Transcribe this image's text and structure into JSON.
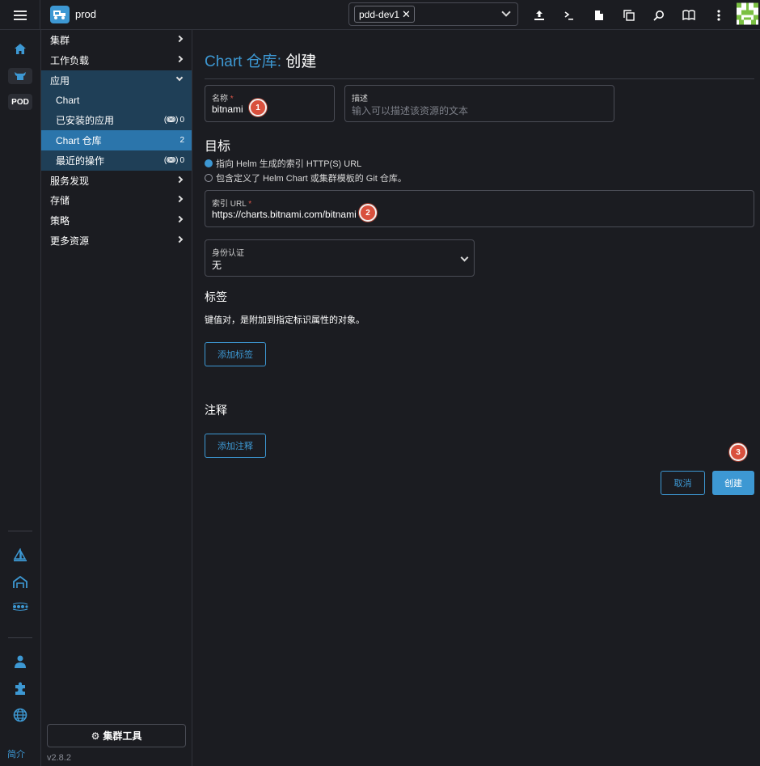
{
  "header": {
    "cluster_name": "prod",
    "namespace_chip": "pdd-dev1",
    "icons": [
      "upload-icon",
      "terminal-icon",
      "file-icon",
      "copy-icon",
      "search-icon",
      "book-icon",
      "more-icon"
    ]
  },
  "rail": {
    "pod_label": "POD",
    "about": "简介"
  },
  "sidenav": {
    "groups": [
      {
        "label": "集群"
      },
      {
        "label": "工作负载"
      },
      {
        "label": "应用"
      },
      {
        "label": "服务发现"
      },
      {
        "label": "存储"
      },
      {
        "label": "策略"
      },
      {
        "label": "更多资源"
      }
    ],
    "app_children": [
      {
        "label": "Chart",
        "count": ""
      },
      {
        "label": "已安装的应用",
        "count": "0"
      },
      {
        "label": "Chart 仓库",
        "count": "2"
      },
      {
        "label": "最近的操作",
        "count": "0"
      }
    ],
    "cluster_tools": "集群工具",
    "version": "v2.8.2"
  },
  "page": {
    "title_prefix": "Chart 仓库:",
    "title_main": "创建"
  },
  "form": {
    "name": {
      "label": "名称",
      "required_mark": "*",
      "value": "bitnami"
    },
    "description": {
      "label": "描述",
      "placeholder": "输入可以描述该资源的文本"
    },
    "target_heading": "目标",
    "target_options": [
      {
        "label": "指向 Helm 生成的索引 HTTP(S) URL",
        "selected": true
      },
      {
        "label": "包含定义了 Helm Chart 或集群模板的 Git 仓库。",
        "selected": false
      }
    ],
    "index_url": {
      "label": "索引 URL",
      "required_mark": "*",
      "value": "https://charts.bitnami.com/bitnami"
    },
    "auth": {
      "label": "身份认证",
      "value": "无"
    },
    "labels_heading": "标签",
    "labels_desc": "键值对，是附加到指定标识属性的对象。",
    "add_label": "添加标签",
    "annotations_heading": "注释",
    "add_annotation": "添加注释",
    "cancel": "取消",
    "create": "创建"
  },
  "steps": {
    "one": "1",
    "two": "2",
    "three": "3"
  },
  "colors": {
    "accent": "#3d98d3",
    "background": "#1b1c21",
    "nav_open": "#1f3f57",
    "nav_active": "#2b75ab",
    "step_badge": "#d9503d"
  }
}
